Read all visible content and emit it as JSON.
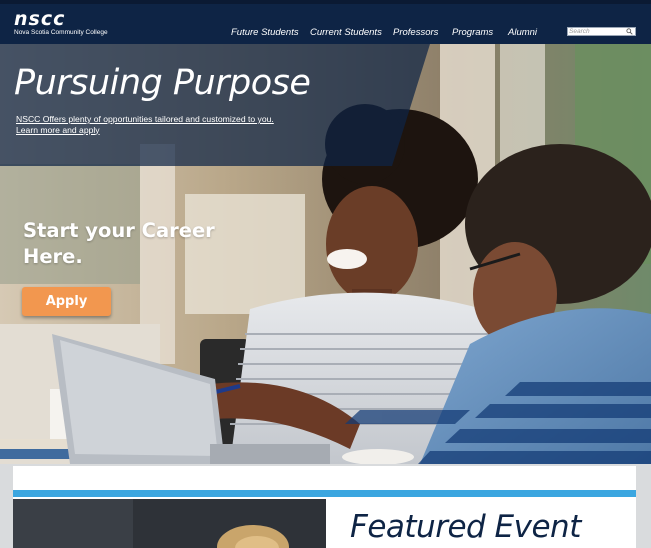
{
  "header": {
    "logo": "nscc",
    "logo_subtitle": "Nova Scotia Community College",
    "nav": [
      "Future Students",
      "Current Students",
      "Professors",
      "Programs",
      "Alumni"
    ],
    "search_placeholder": "Search"
  },
  "hero": {
    "title": "Pursuing Purpose",
    "subtitle_lines": [
      "NSCC Offers plenty of opportunities tailored  and customized to you.",
      "Learn more and apply"
    ],
    "cta_heading": "Start your Career Here.",
    "apply_label": "Apply"
  },
  "featured": {
    "title": "Featured Event"
  },
  "colors": {
    "navy": "#0e2445",
    "accent_orange": "#f2974f",
    "accent_blue": "#3ba6e0"
  }
}
